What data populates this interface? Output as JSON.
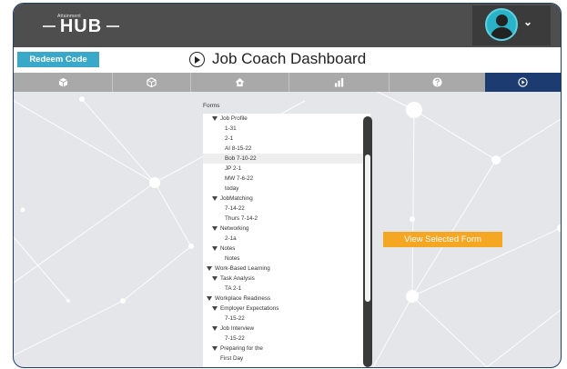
{
  "header": {
    "logo_small": "Attainment",
    "logo_main": "HUB",
    "avatar_caret": "⌄"
  },
  "subbar": {
    "redeem_label": "Redeem Code",
    "page_title": "Job Coach Dashboard"
  },
  "nav": {
    "tabs": [
      {
        "icon": "box-icon"
      },
      {
        "icon": "cube-icon"
      },
      {
        "icon": "home-icon"
      },
      {
        "icon": "bar-chart-icon"
      },
      {
        "icon": "question-icon"
      },
      {
        "icon": "play-icon"
      }
    ],
    "active_tab_index": 5
  },
  "forms": {
    "label": "Forms",
    "items": [
      {
        "text": "Job Profile",
        "level": 1,
        "expander": true
      },
      {
        "text": "1-31",
        "level": 2
      },
      {
        "text": "2-1",
        "level": 2
      },
      {
        "text": "AI 8-15-22",
        "level": 2
      },
      {
        "text": "Bob 7-10-22",
        "level": 2,
        "selected": true
      },
      {
        "text": "JP 2-1",
        "level": 2
      },
      {
        "text": "MW 7-6-22",
        "level": 2
      },
      {
        "text": "today",
        "level": 2
      },
      {
        "text": "JobMatching",
        "level": 1,
        "expander": true
      },
      {
        "text": "7-14-22",
        "level": 2
      },
      {
        "text": "Thurs 7-14-2",
        "level": 2
      },
      {
        "text": "Networking",
        "level": 1,
        "expander": true
      },
      {
        "text": "2-1a",
        "level": 2
      },
      {
        "text": "Notes",
        "level": 1,
        "expander": true
      },
      {
        "text": "Notes",
        "level": 2
      },
      {
        "text": "Work-Based Learning",
        "level": 0,
        "expander": true
      },
      {
        "text": "Task Analysis",
        "level": 1,
        "expander": true
      },
      {
        "text": "TA 2-1",
        "level": 2
      },
      {
        "text": "Workplace Readiness",
        "level": 0,
        "expander": true
      },
      {
        "text": "Employer Expectations",
        "level": 1,
        "expander": true
      },
      {
        "text": "7-15-22",
        "level": 2
      },
      {
        "text": "Job Interview",
        "level": 1,
        "expander": true
      },
      {
        "text": "7-15-22",
        "level": 2
      },
      {
        "text": "Preparing for the",
        "level": 1,
        "expander": true
      },
      {
        "text": "First Day",
        "level": 1,
        "continuation": true
      }
    ]
  },
  "actions": {
    "view_selected_label": "View Selected Form"
  },
  "colors": {
    "topbar": "#4e4e4e",
    "redeem": "#3aa8c8",
    "nav_active": "#1c3b70",
    "view_button": "#f5a623"
  }
}
